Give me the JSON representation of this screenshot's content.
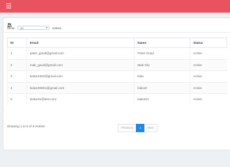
{
  "header": {
    "menu_icon": "hamburger-icon",
    "bar_color": "#e8535f"
  },
  "card": {
    "icon": "users-icon"
  },
  "length_control": {
    "show_label": "Show",
    "selected": "10",
    "entries_label": "entries"
  },
  "table": {
    "columns": [
      "ID",
      "Email",
      "Name",
      "Status"
    ],
    "rows": [
      [
        "1",
        "peter_goud@gmail.com",
        "Peter Goud",
        "Active"
      ],
      [
        "2",
        "mak_goud@gmail.com",
        "Mak Glu",
        "Active"
      ],
      [
        "3",
        "kida12322@gmail.com",
        "kida",
        "Active"
      ],
      [
        "4",
        "kida100001@gmail.com",
        "kida10",
        "Active"
      ],
      [
        "5",
        "kida101@test.com",
        "kida101",
        "Active"
      ]
    ]
  },
  "info": "Showing 1 to 5 of 5 entries",
  "pagination": {
    "previous": "Previous",
    "current": "1",
    "next": "Next",
    "active_color": "#1e88e5"
  }
}
